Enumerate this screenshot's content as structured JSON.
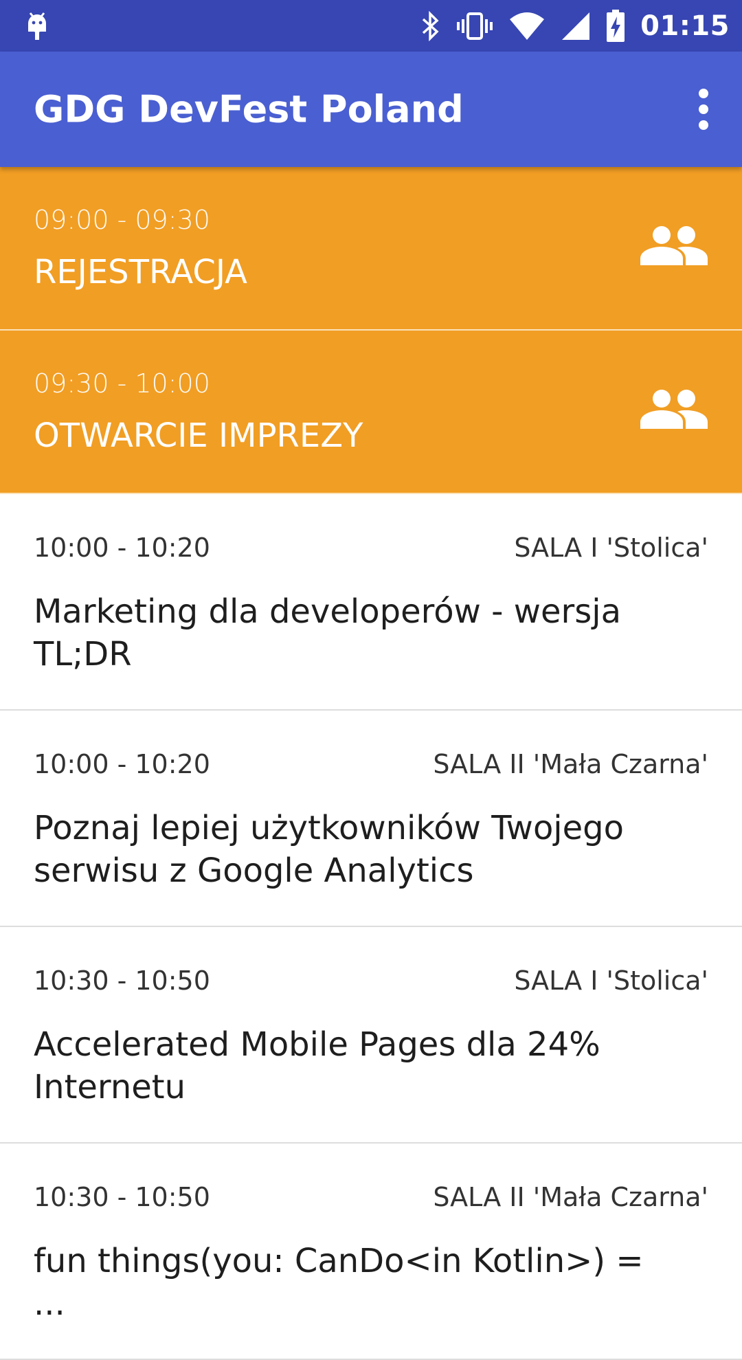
{
  "status_bar": {
    "left_icon": "android-debug-icon",
    "icons": [
      "bluetooth-icon",
      "vibrate-icon",
      "wifi-icon",
      "cell-signal-icon",
      "battery-charging-icon"
    ],
    "time": "01:15"
  },
  "app_bar": {
    "title": "GDG DevFest Poland",
    "menu_icon": "more-vert-icon"
  },
  "colors": {
    "status_bar": "#3746b2",
    "app_bar": "#4a5fd1",
    "highlight_item": "#f19e24"
  },
  "schedule": {
    "highlighted": [
      {
        "time": "09:00 - 09:30",
        "title": "REJESTRACJA",
        "icon": "people-icon"
      },
      {
        "time": "09:30 - 10:00",
        "title": "OTWARCIE IMPREZY",
        "icon": "people-icon"
      }
    ],
    "sessions": [
      {
        "time": "10:00 - 10:20",
        "room": "SALA I 'Stolica'",
        "title": "Marketing dla developerów - wersja TL;DR"
      },
      {
        "time": "10:00 - 10:20",
        "room": "SALA II 'Mała Czarna'",
        "title": "Poznaj lepiej użytkowników Twojego serwisu z Google Analytics"
      },
      {
        "time": "10:30 - 10:50",
        "room": "SALA I 'Stolica'",
        "title": "Accelerated Mobile Pages dla 24% Internetu"
      },
      {
        "time": "10:30 - 10:50",
        "room": "SALA II 'Mała Czarna'",
        "title": "fun things(you: CanDo<in Kotlin>) = ..."
      }
    ]
  }
}
